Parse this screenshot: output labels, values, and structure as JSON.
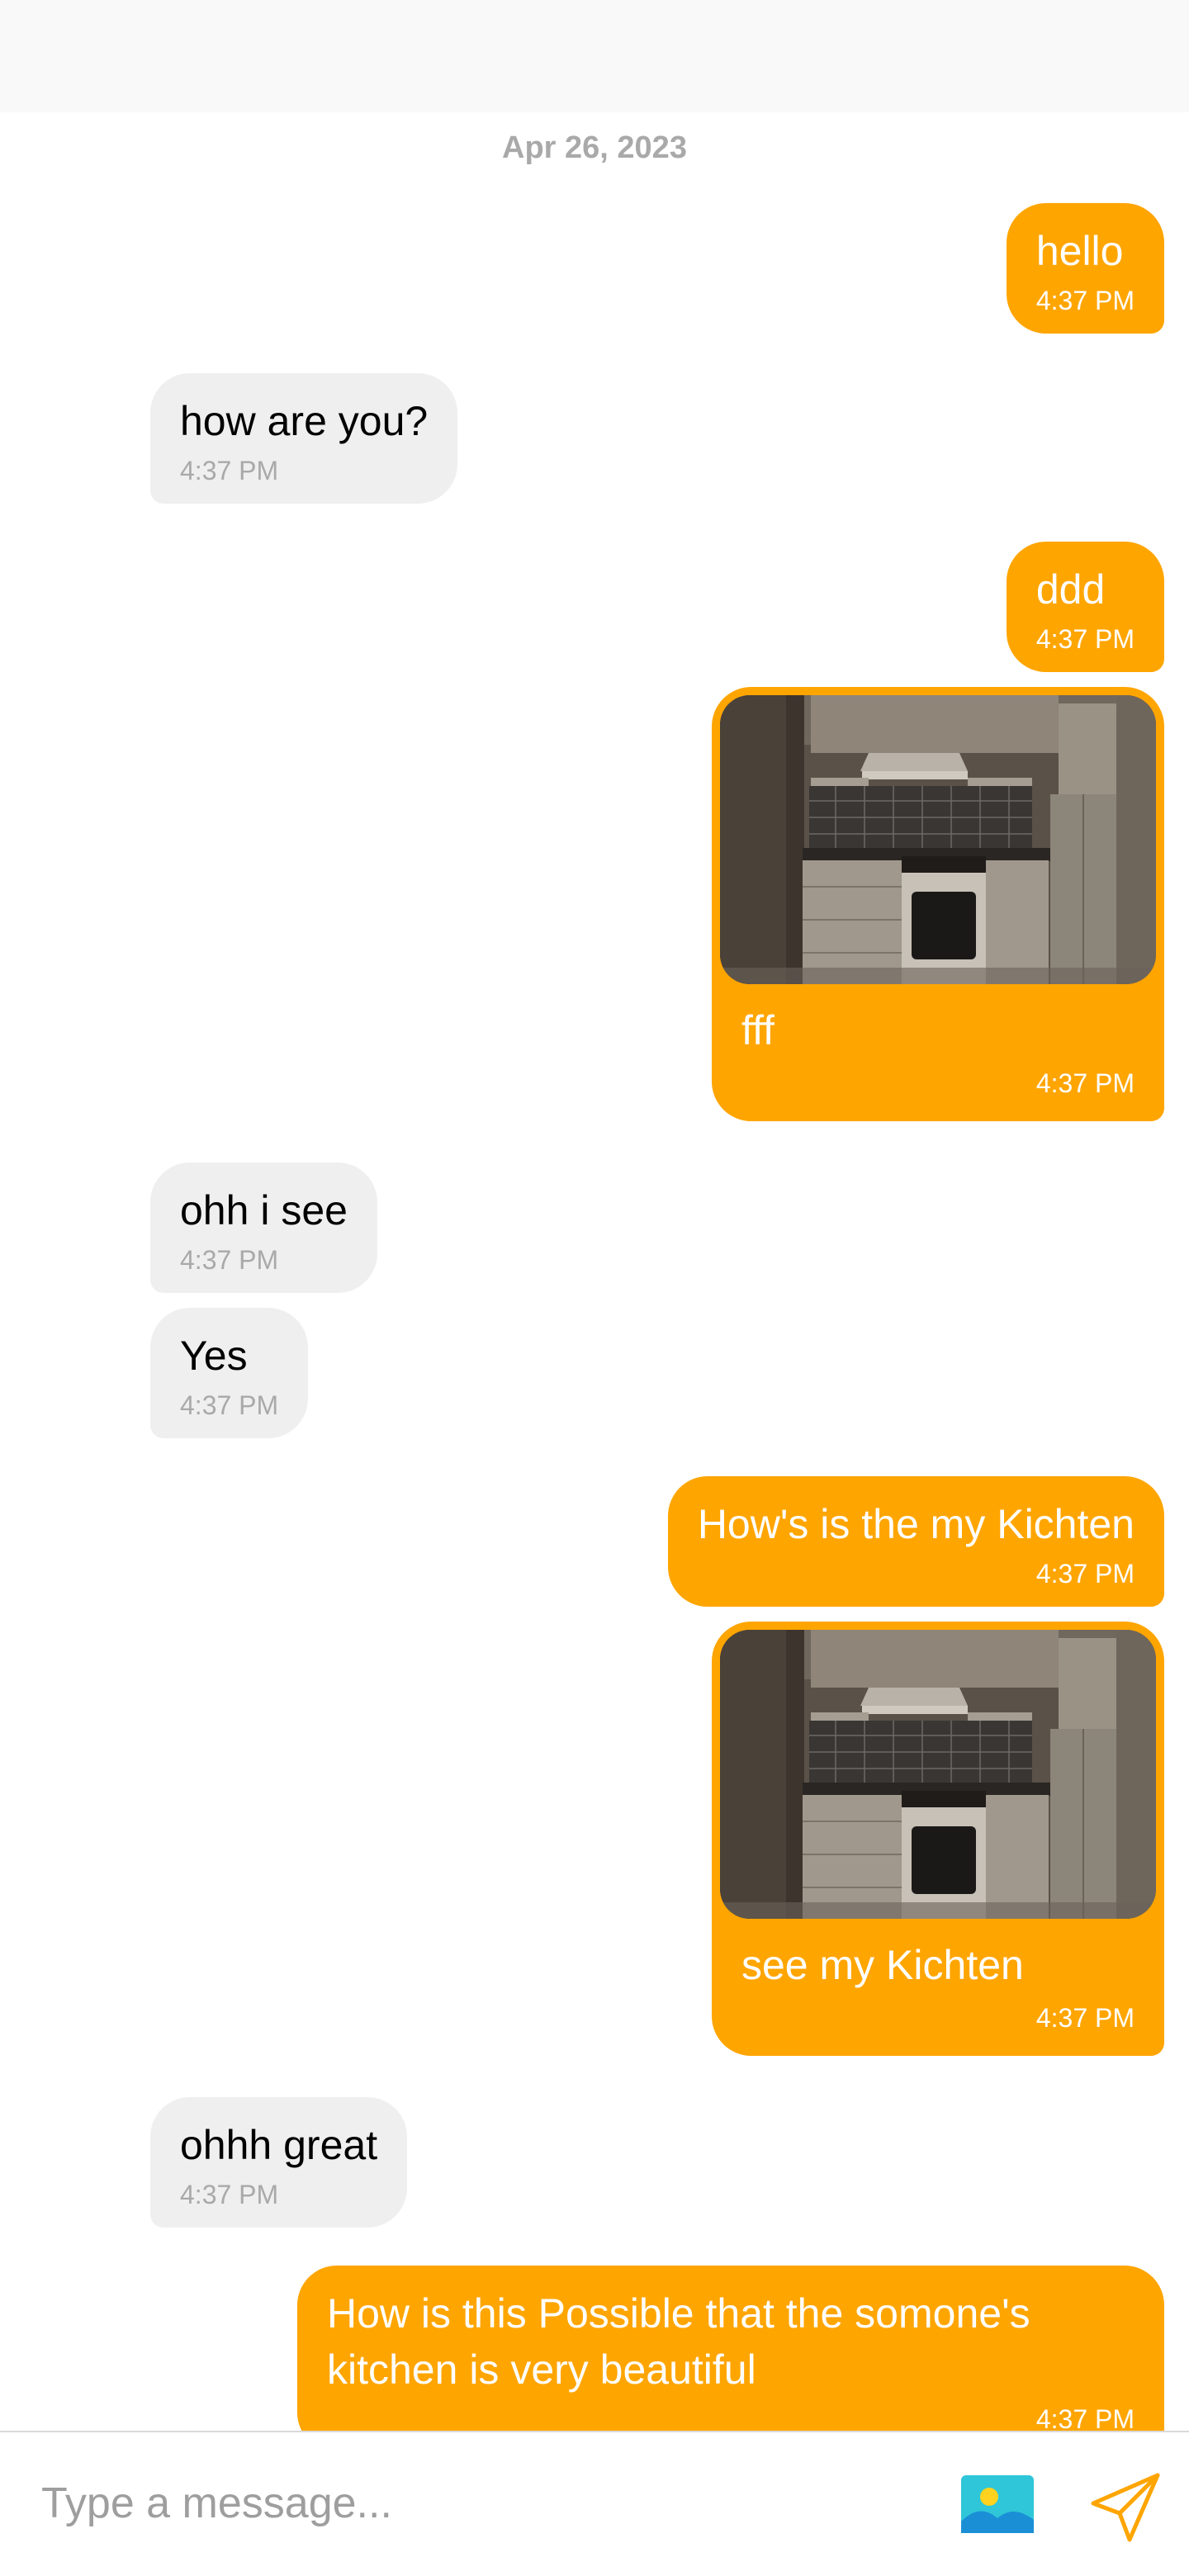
{
  "chat": {
    "date_separator": "Apr 26, 2023",
    "messages": [
      {
        "text": "hello",
        "time": "4:37 PM"
      },
      {
        "text": "how are you?",
        "time": "4:37 PM"
      },
      {
        "text": "ddd",
        "time": "4:37 PM"
      },
      {
        "text": "fff",
        "time": "4:37 PM",
        "image": "kitchen-photo"
      },
      {
        "text": "ohh i see",
        "time": "4:37 PM"
      },
      {
        "text": "Yes",
        "time": "4:37 PM"
      },
      {
        "text": "How's is the my Kichten",
        "time": "4:37 PM"
      },
      {
        "text": "see my Kichten",
        "time": "4:37 PM",
        "image": "kitchen-photo"
      },
      {
        "text": "ohhh great",
        "time": "4:37 PM"
      },
      {
        "text": "How is this Possible that the somone's kitchen is very beautiful",
        "text_line1": "How is this Possible that the somone's",
        "text_line2": "kitchen is very beautiful",
        "time": "4:37 PM"
      }
    ]
  },
  "composer": {
    "placeholder": "Type a message...",
    "gallery_icon": "image-gallery-icon",
    "send_icon": "send-icon"
  },
  "colors": {
    "outgoing_bubble": "#ffa500",
    "incoming_bubble": "#efefef",
    "timestamp_incoming": "#a9a9a9",
    "date_separator": "#a9a9a9"
  }
}
